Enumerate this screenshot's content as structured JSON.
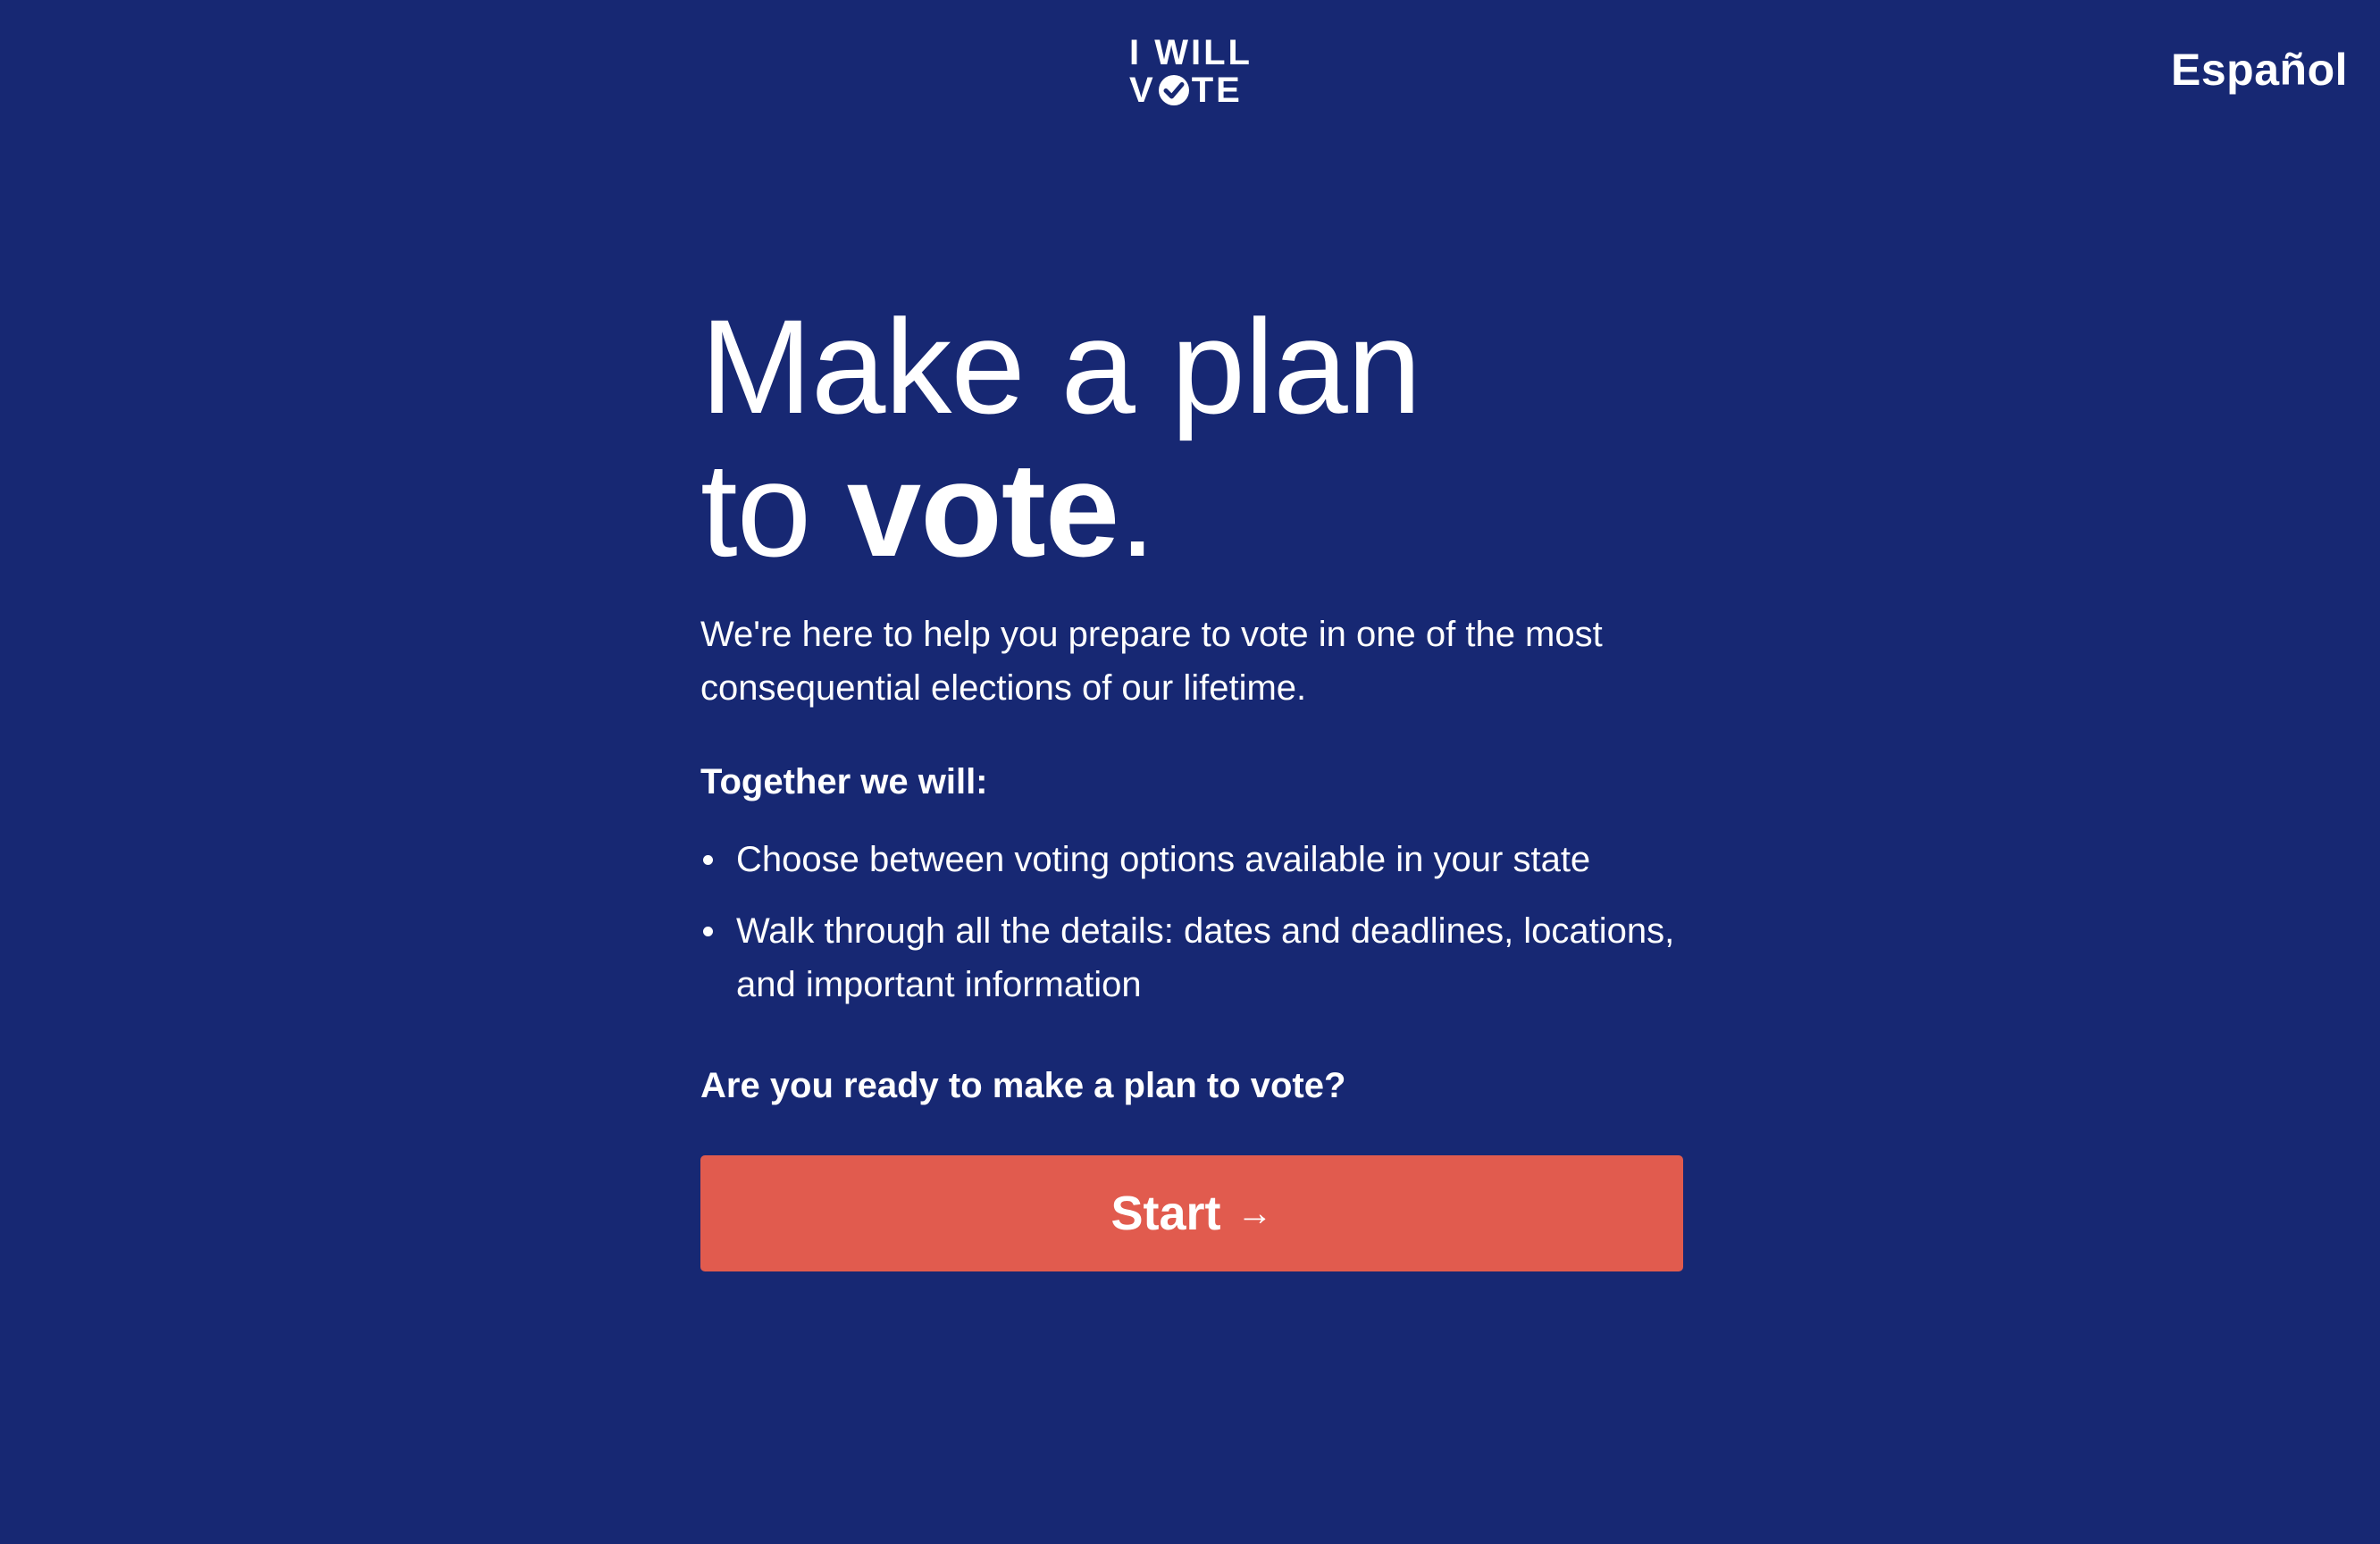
{
  "header": {
    "logo_top": "I WILL",
    "logo_bottom_left": "V",
    "logo_bottom_right": "TE",
    "language_link": "Español"
  },
  "main": {
    "headline_line1": "Make a plan",
    "headline_line2_prefix": "to ",
    "headline_line2_bold": "vote",
    "headline_line2_suffix": ".",
    "intro": "We're here to help you prepare to vote in one of the most consequential elections of our lifetime.",
    "together_heading": "Together we will:",
    "bullets": [
      "Choose between voting options available in your state",
      "Walk through all the details: dates and deadlines, locations, and important information"
    ],
    "ready_question": "Are you ready to make a plan to vote?",
    "start_label": "Start",
    "start_arrow": "→"
  },
  "colors": {
    "background": "#172873",
    "button": "#e15b4e",
    "text": "#ffffff"
  },
  "icons": {
    "logo_checkmark": "check-circle-icon",
    "start_arrow": "arrow-right-icon"
  }
}
